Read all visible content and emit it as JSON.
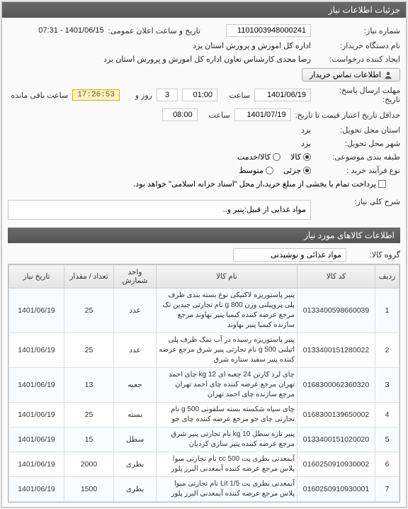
{
  "header": {
    "title": "جزئیات اطلاعات نیاز"
  },
  "fields": {
    "need_number_label": "شماره نیاز:",
    "need_number": "1101003948000241",
    "public_time_label": "تاریخ و ساعت اعلان عمومی:",
    "public_time": "1401/06/15 - 07:31",
    "buyer_label": "نام دستگاه خریدار:",
    "buyer": "اداره کل اموزش و پرورش استان یزد",
    "requester_label": "ایجاد کننده درخواست:",
    "requester": "رضا محدی کارشناس تعاون اداره کل اموزش و پرورش استان یزد",
    "contact_btn": "اطلاعات تماس خریدار",
    "response_deadline_label": "مهلت ارسال پاسخ:",
    "to_date_label": "تاریخ:",
    "deadline_date": "1401/06/19",
    "hour_label": "ساعت",
    "deadline_hour": "01:00",
    "day_label": "روز و",
    "remain_days": "3",
    "remain_time": "17:26:53",
    "remain_label": "ساعت باقی مانده",
    "credit_label": "حداقل تاریخ اعتبار قیمت تا تاریخ:",
    "credit_date": "1401/07/19",
    "credit_hour": "08:00",
    "delivery_state_label": "استان محل تحویل:",
    "delivery_state": "یزد",
    "delivery_city_label": "شهر محل تحویل:",
    "delivery_city": "یزد",
    "subject_cat_label": "طبقه بندی موضوعی:",
    "subject_opts": {
      "goods": "کالا",
      "service": "کالا/خدمت"
    },
    "process_label": "نوع فرآیند خرید :",
    "process_opts": {
      "minor": "جزئی",
      "mid": "متوسط"
    },
    "pay_note": "پرداخت تمام یا بخشی از مبلغ خرید،از محل \"اسناد خزانه اسلامی\" خواهد بود.",
    "need_desc_label": "شرح کلی نیاز:",
    "need_desc": "مواد غذایی از قبیل:پنیر و..",
    "goods_section": "اطلاعات کالاهای مورد نیاز",
    "group_label": "گروه کالا:",
    "group_value": "مواد غذائی و نوشیدنی"
  },
  "table": {
    "headers": {
      "row": "ردیف",
      "code": "کد کالا",
      "name": "نام کالا",
      "unit": "واحد شمارش",
      "qty": "تعداد / مقدار",
      "date": "تاریخ نیاز"
    },
    "rows": [
      {
        "n": 1,
        "code": "0133400598660039",
        "name": "پنیر پاستوریزه لاکتیکی نوع بسته بندی ظرف پلی پروپیلنی وزن g 800 نام تجارتی جیدین تک مرجع عرضه کننده کیمیا پنیر نهاوند مرجع سازنده کیمیا پنیر نهاوند",
        "unit": "عدد",
        "qty": "25",
        "date": "1401/06/19"
      },
      {
        "n": 2,
        "code": "0133400151280022",
        "name": "پنیر پاستوریزه رسیده در آب نمک ظرف پلی اتیلنی g 500 نام تجارتی پنیر شرق مرجع عرضه کننده پنیر سفید ستاره شرق",
        "unit": "عدد",
        "qty": "25",
        "date": "1401/06/19"
      },
      {
        "n": 3,
        "code": "0168300062360320",
        "name": "چای لرد کارتن 24 جعبه ای kg 12 چای احمد تهران مرجع عرضه کننده چای احمد تهران مرجع سازنده چای احمد تهران",
        "unit": "جعبه",
        "qty": "13",
        "date": "1401/06/19"
      },
      {
        "n": 4,
        "code": "0168300139650002",
        "name": "چای سیاه شکسته بسته سلفونی g 500 نام تجارتی چای جو مرجع عرضه کننده چای جو",
        "unit": "بسته",
        "qty": "25",
        "date": "1401/06/19"
      },
      {
        "n": 5,
        "code": "0133400151020020",
        "name": "پنیر تازه سطل kg 10 نام تجارتی پنیر شرق مرجع عرضه کننده پنیر سازی کردیان",
        "unit": "سطل",
        "qty": "15",
        "date": "1401/06/19"
      },
      {
        "n": 6,
        "code": "0160250910930002",
        "name": "آبمعدنی بطری پت cc 500 نام تجارتی میوا پلاس مرجع عرضه کننده آبمعدنی البرز پلور",
        "unit": "بطری",
        "qty": "2000",
        "date": "1401/06/19"
      },
      {
        "n": 7,
        "code": "0160250910930001",
        "name": "آبمعدنی بطری پت Lit 1/5 نام تجارتی میوا پلاس مرجع عرضه کننده آبمعدنی البرز پلور",
        "unit": "بطری",
        "qty": "1500",
        "date": "1401/06/19"
      }
    ]
  }
}
